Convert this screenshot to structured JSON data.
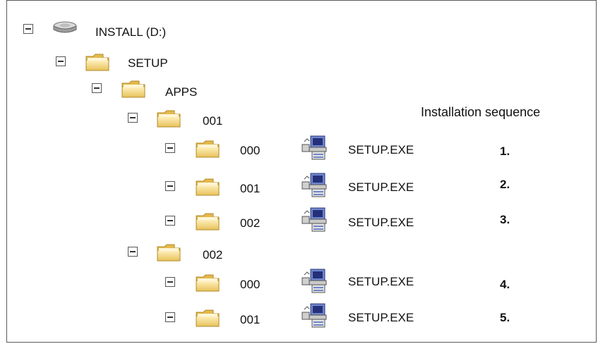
{
  "tree": {
    "drive": {
      "label": "INSTALL (D:)",
      "icon": "drive-icon"
    },
    "setup": {
      "label": "SETUP",
      "icon": "folder-icon"
    },
    "apps": {
      "label": "APPS",
      "icon": "folder-icon"
    },
    "groups": [
      {
        "label": "001",
        "children": [
          {
            "label": "000",
            "file": "SETUP.EXE",
            "step": "1."
          },
          {
            "label": "001",
            "file": "SETUP.EXE",
            "step": "2."
          },
          {
            "label": "002",
            "file": "SETUP.EXE",
            "step": "3."
          }
        ]
      },
      {
        "label": "002",
        "children": [
          {
            "label": "000",
            "file": "SETUP.EXE",
            "step": "4."
          },
          {
            "label": "001",
            "file": "SETUP.EXE",
            "step": "5."
          }
        ]
      }
    ]
  },
  "sequence_heading": "Installation sequence",
  "icons": {
    "folder": "folder-icon",
    "drive": "drive-icon",
    "executable": "setup-exe-icon",
    "collapse": "minus-box-icon"
  },
  "colors": {
    "border": "#5a5a5a",
    "folder_light": "#fbe6a3",
    "folder_dark": "#e3b84c"
  }
}
